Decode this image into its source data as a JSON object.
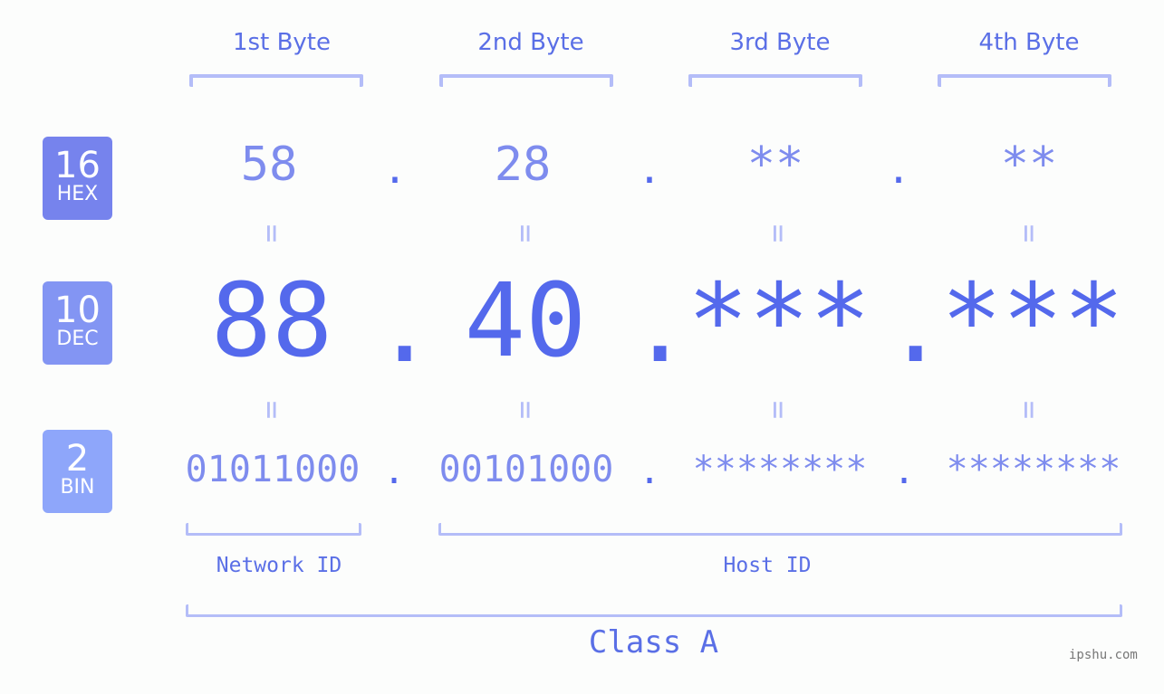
{
  "headers": [
    "1st Byte",
    "2nd Byte",
    "3rd Byte",
    "4th Byte"
  ],
  "badges": {
    "hex": {
      "number": "16",
      "label": "HEX",
      "color": "#7683ed"
    },
    "dec": {
      "number": "10",
      "label": "DEC",
      "color": "#8395f3"
    },
    "bin": {
      "number": "2",
      "label": "BIN",
      "color": "#8ea6fa"
    }
  },
  "hex_values": [
    "58",
    "28",
    "**",
    "**"
  ],
  "dec_values": [
    "88",
    "40",
    "***",
    "***"
  ],
  "bin_values": [
    "01011000",
    "00101000",
    "********",
    "********"
  ],
  "separator": ".",
  "equals": "=",
  "network_label": "Network ID",
  "host_label": "Host ID",
  "class_label": "Class A",
  "watermark": "ipshu.com",
  "colors": {
    "accent": "#5469ec",
    "light_accent": "#7e8cee",
    "bracket": "#b4bdf8",
    "background": "#fcfdfc"
  }
}
